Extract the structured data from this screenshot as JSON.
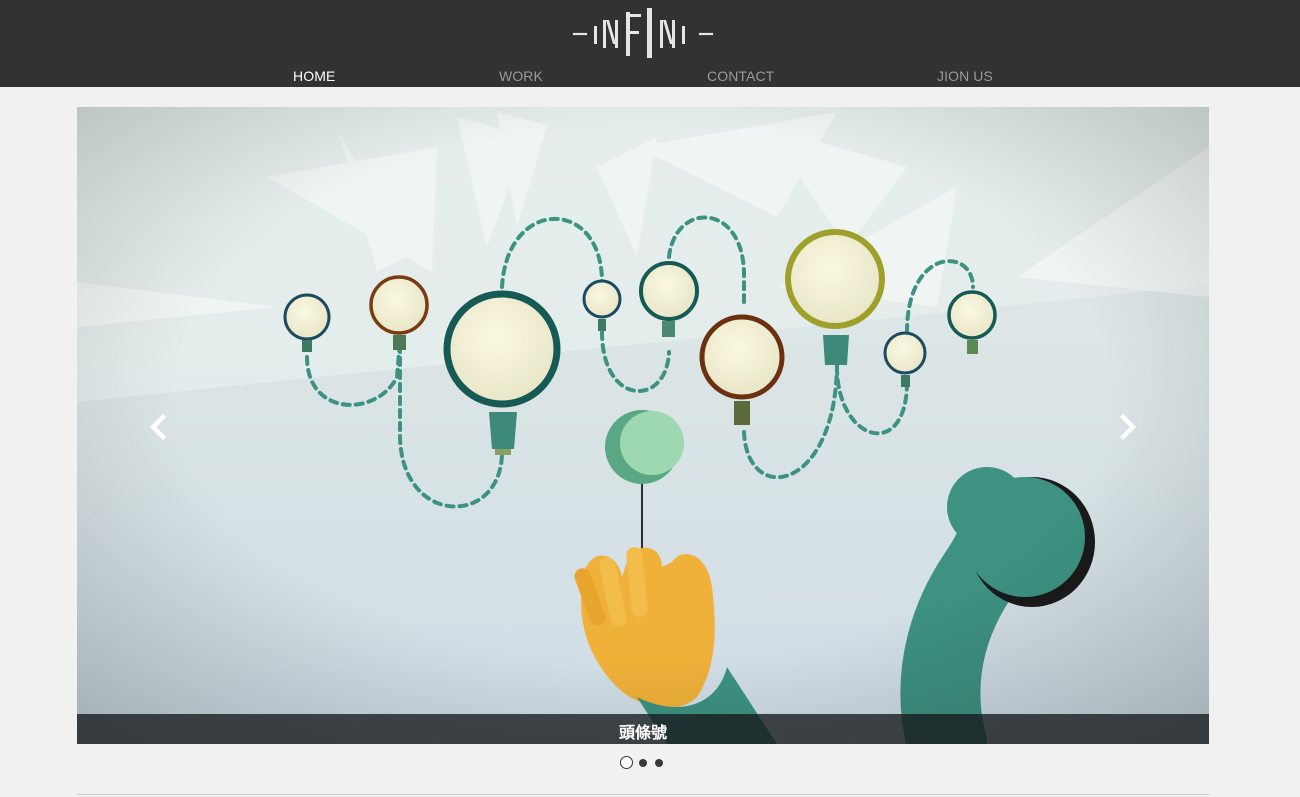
{
  "brand": {
    "logo_text": "INFINI"
  },
  "nav": {
    "items": [
      {
        "label": "HOME",
        "active": true
      },
      {
        "label": "WORK",
        "active": false
      },
      {
        "label": "CONTACT",
        "active": false
      },
      {
        "label": "JION US",
        "active": false
      }
    ]
  },
  "carousel": {
    "caption": "頭條號",
    "slide_count": 3,
    "active_index": 0,
    "prev_icon": "chevron-left-icon",
    "next_icon": "chevron-right-icon"
  },
  "colors": {
    "header_bg": "#323232",
    "page_bg": "#f1f1f1",
    "nav_active": "#ffffff",
    "nav_inactive": "#9a9a9a",
    "teal": "#3d9282",
    "mustard": "#f0b13a"
  }
}
